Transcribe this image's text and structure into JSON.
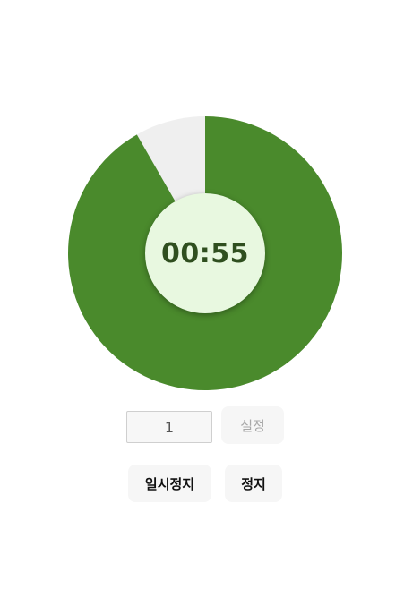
{
  "timer": {
    "display": "00:55",
    "remaining_fraction": 0.917,
    "colors": {
      "elapsed": "#efefef",
      "remaining": "#4a8a2c",
      "center": "#e8f8e0",
      "text": "#2f4f1f"
    }
  },
  "controls": {
    "minutes_value": "1",
    "set_label": "설정",
    "pause_label": "일시정지",
    "stop_label": "정지"
  }
}
